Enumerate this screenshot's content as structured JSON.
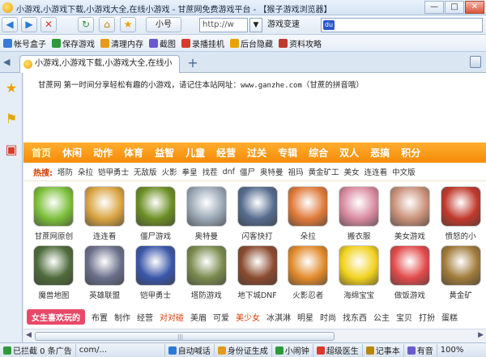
{
  "window": {
    "title": "小游戏,小游戏下载,小游戏大全,在线小游戏 - 甘蔗网免费游戏平台 - 【猴子游戏浏览器】",
    "minimize": "—",
    "maximize": "□",
    "close": "✕"
  },
  "toolbar": {
    "back": "◀",
    "forward": "▶",
    "stop": "✕",
    "refresh": "↻",
    "home": "⌂",
    "favorite": "★",
    "small_mode": "小号",
    "address": "http://w",
    "go": "▼",
    "speed_mode": "游戏变速",
    "search_placeholder": ""
  },
  "favbar": {
    "items": [
      {
        "label": "帐号盒子",
        "color": "#3a7bd5"
      },
      {
        "label": "保存游戏",
        "color": "#2d9a3a"
      },
      {
        "label": "清理内存",
        "color": "#e59a1c"
      },
      {
        "label": "截图",
        "color": "#6a5acd"
      },
      {
        "label": "录播挂机",
        "color": "#d83a2b"
      },
      {
        "label": "后台隐藏",
        "color": "#e6a300"
      },
      {
        "label": "资料攻略",
        "color": "#c0392b"
      }
    ]
  },
  "tabs": {
    "active_label": "小游戏,小游戏下载,小游戏大全,在线小",
    "new_tab": "+"
  },
  "page": {
    "intro_prefix": "甘蔗网 第一时间分享轻松有趣的小游戏，请记住本站网址：",
    "intro_site": "www.ganzhe.com",
    "intro_suffix": "（甘蔗的拼音哦）",
    "menu": [
      "首页",
      "休闲",
      "动作",
      "体育",
      "益智",
      "儿童",
      "经营",
      "过关",
      "专辑",
      "综合",
      "双人",
      "恶搞",
      "积分"
    ],
    "hot_label": "热搜:",
    "hot_links": [
      "塔防",
      "朵拉",
      "铠甲勇士",
      "无敌版",
      "火影",
      "拳皇",
      "找茬",
      "dnf",
      "僵尸",
      "奥特曼",
      "祖玛",
      "黄金矿工",
      "美女",
      "连连看",
      "中文版"
    ],
    "games_row1": [
      {
        "label": "甘蔗网原创",
        "color": "#7bbf3a"
      },
      {
        "label": "连连看",
        "color": "#d9a441"
      },
      {
        "label": "僵尸游戏",
        "color": "#6b8e23"
      },
      {
        "label": "奥特曼",
        "color": "#9aa7b5"
      },
      {
        "label": "闪客快打",
        "color": "#556b8e"
      },
      {
        "label": "朵拉",
        "color": "#e07a3a"
      },
      {
        "label": "搬衣服",
        "color": "#d98aa0"
      },
      {
        "label": "美女游戏",
        "color": "#c99078"
      },
      {
        "label": "愤怒的小",
        "color": "#c0392b"
      }
    ],
    "games_row2": [
      {
        "label": "魔兽地图",
        "color": "#4e6b3a"
      },
      {
        "label": "英雄联盟",
        "color": "#6a6f8a"
      },
      {
        "label": "铠甲勇士",
        "color": "#3a56a8"
      },
      {
        "label": "塔防游戏",
        "color": "#7a8a4e"
      },
      {
        "label": "地下城DNF",
        "color": "#8a4a2e"
      },
      {
        "label": "火影忍者",
        "color": "#e28a2b"
      },
      {
        "label": "海绵宝宝",
        "color": "#f2d21e"
      },
      {
        "label": "做饭游戏",
        "color": "#e24a4a"
      },
      {
        "label": "黄金矿",
        "color": "#a07a3a"
      }
    ],
    "girls_tag": "女生喜欢玩的",
    "girls_links": [
      {
        "label": "布置",
        "hl": false
      },
      {
        "label": "制作",
        "hl": false
      },
      {
        "label": "经营",
        "hl": false
      },
      {
        "label": "对对碰",
        "hl": true
      },
      {
        "label": "美眉",
        "hl": false
      },
      {
        "label": "可爱",
        "hl": false
      },
      {
        "label": "美少女",
        "hl": true
      },
      {
        "label": "冰淇淋",
        "hl": false
      },
      {
        "label": "明星",
        "hl": false
      },
      {
        "label": "时尚",
        "hl": false
      },
      {
        "label": "找东西",
        "hl": false
      },
      {
        "label": "公主",
        "hl": false
      },
      {
        "label": "宝贝",
        "hl": false
      },
      {
        "label": "打扮",
        "hl": false
      },
      {
        "label": "蛋糕",
        "hl": false
      }
    ]
  },
  "statusbar": {
    "blocked": "已拦截 0 条广告",
    "url": "com/...",
    "items": [
      "自动喊话",
      "身份证生成",
      "小闹钟",
      "超级医生",
      "记事本",
      "有音"
    ],
    "zoom": "100%"
  },
  "colors": {
    "menu_bg": "#f58c07",
    "accent_red": "#d63a00",
    "tag_pink": "#e8496a"
  }
}
